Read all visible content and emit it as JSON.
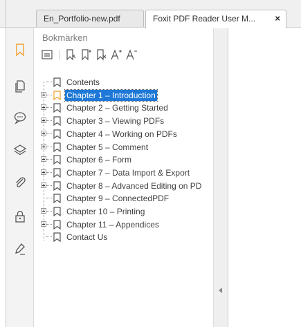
{
  "tabs": [
    {
      "label": "En_Portfolio-new.pdf",
      "active": false
    },
    {
      "label": "Foxit PDF Reader User M...",
      "active": true,
      "close": "×"
    }
  ],
  "panel": {
    "title": "Bokmärken",
    "toolbar": [
      "collapse-all-icon",
      "new-bookmark-icon",
      "add-child-bookmark-icon",
      "delete-bookmark-icon",
      "increase-font-size-icon",
      "decrease-font-size-icon"
    ]
  },
  "sidebar": {
    "icons": [
      "bookmark-icon",
      "pages-icon",
      "comment-icon",
      "layers-icon",
      "attachment-icon",
      "security-icon",
      "signature-icon"
    ]
  },
  "bookmarks": [
    {
      "label": "Contents",
      "expandable": false,
      "selected": false
    },
    {
      "label": "Chapter 1 – Introduction",
      "expandable": true,
      "selected": true
    },
    {
      "label": "Chapter 2 – Getting Started",
      "expandable": true,
      "selected": false
    },
    {
      "label": "Chapter 3 – Viewing PDFs",
      "expandable": true,
      "selected": false
    },
    {
      "label": "Chapter 4 – Working on PDFs",
      "expandable": true,
      "selected": false
    },
    {
      "label": "Chapter 5 – Comment",
      "expandable": true,
      "selected": false
    },
    {
      "label": "Chapter 6 – Form",
      "expandable": true,
      "selected": false
    },
    {
      "label": "Chapter 7 – Data Import & Export",
      "expandable": true,
      "selected": false
    },
    {
      "label": "Chapter 8 – Advanced Editing on PD",
      "expandable": true,
      "selected": false
    },
    {
      "label": "Chapter 9 – ConnectedPDF",
      "expandable": false,
      "selected": false
    },
    {
      "label": "Chapter 10 – Printing",
      "expandable": true,
      "selected": false
    },
    {
      "label": "Chapter 11 – Appendices",
      "expandable": true,
      "selected": false
    },
    {
      "label": "Contact Us",
      "expandable": false,
      "selected": false
    }
  ],
  "colors": {
    "accent": "#f0a030",
    "selection": "#1e78d7"
  }
}
